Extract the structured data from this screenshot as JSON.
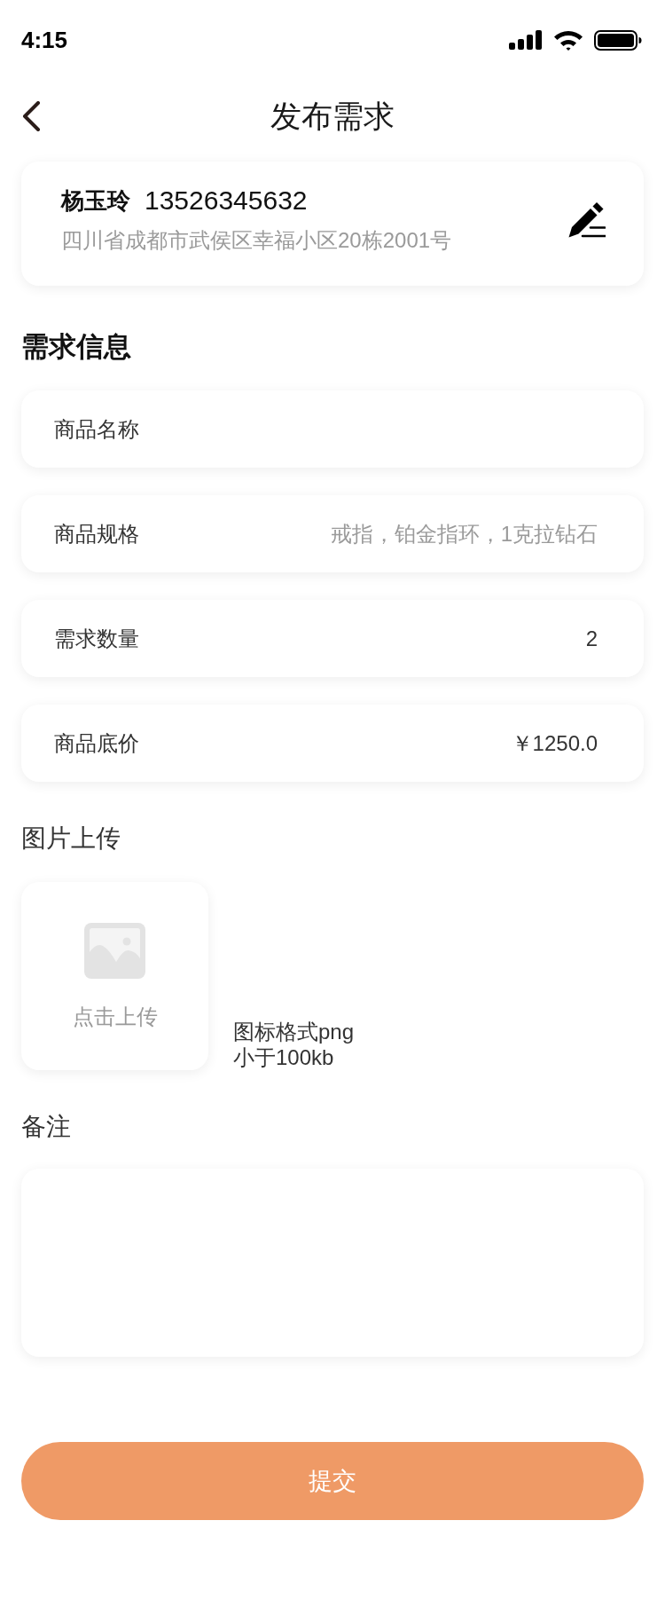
{
  "status_bar": {
    "time": "4:15"
  },
  "header": {
    "title": "发布需求"
  },
  "contact": {
    "name": "杨玉玲",
    "phone": "13526345632",
    "address": "四川省成都市武侯区幸福小区20栋2001号"
  },
  "demand_info": {
    "heading": "需求信息",
    "fields": [
      {
        "label": "商品名称"
      },
      {
        "label": "商品规格",
        "placeholder": "戒指，铂金指环，1克拉钻石"
      },
      {
        "label": "需求数量",
        "value": "2"
      },
      {
        "label": "商品底价",
        "value": "￥1250.0"
      }
    ]
  },
  "image_upload": {
    "heading": "图片上传",
    "upload_label": "点击上传",
    "hint_lines": [
      "图标格式png",
      "小于100kb"
    ]
  },
  "remarks": {
    "heading": "备注"
  },
  "submit_button": {
    "label": "提交"
  }
}
